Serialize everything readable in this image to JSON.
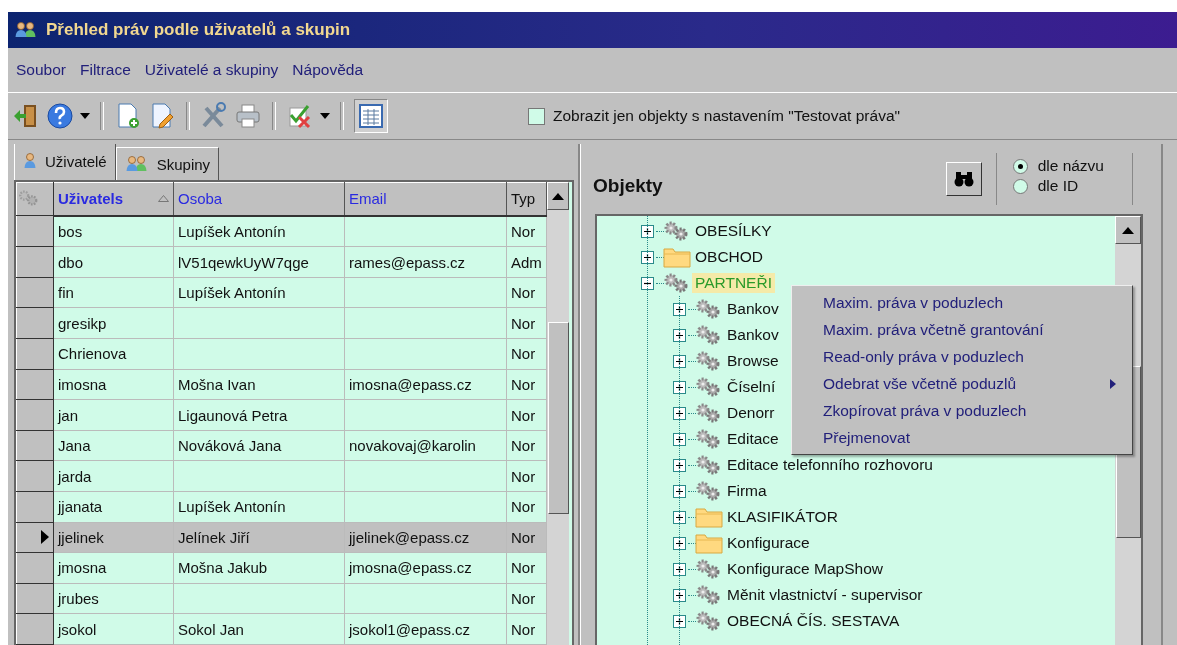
{
  "window": {
    "title": "Přehled práv podle uživatelů a skupin"
  },
  "menu": [
    "Soubor",
    "Filtrace",
    "Uživatelé a skupiny",
    "Nápověda"
  ],
  "toolbar": [
    {
      "kind": "exit"
    },
    {
      "kind": "help"
    },
    {
      "kind": "caret"
    },
    {
      "kind": "sep"
    },
    {
      "kind": "new"
    },
    {
      "kind": "edit"
    },
    {
      "kind": "sep"
    },
    {
      "kind": "tools"
    },
    {
      "kind": "print"
    },
    {
      "kind": "sep"
    },
    {
      "kind": "checkx"
    },
    {
      "kind": "caret"
    },
    {
      "kind": "sep"
    },
    {
      "kind": "grid",
      "pressed": true
    }
  ],
  "filter_checkbox": {
    "label": "Zobrazit jen objekty s nastavením \"Testovat práva\"",
    "checked": false
  },
  "tabs": [
    {
      "label": "Uživatelé",
      "selected": true
    },
    {
      "label": "Skupiny",
      "selected": false
    }
  ],
  "table": {
    "columns": [
      {
        "label": "Uživatels",
        "sorted": true
      },
      {
        "label": "Osoba",
        "sorted": false
      },
      {
        "label": "Email",
        "sorted": false
      },
      {
        "label": "Typ",
        "sorted": false
      }
    ],
    "rows": [
      {
        "cells": [
          "bos",
          "Lupíšek Antonín",
          "",
          "Nor"
        ],
        "selected": false
      },
      {
        "cells": [
          "dbo",
          "lV51qewkUyW7qge",
          "rames@epass.cz",
          "Adm"
        ],
        "selected": false
      },
      {
        "cells": [
          "fin",
          "Lupíšek Antonín",
          "",
          "Nor"
        ],
        "selected": false
      },
      {
        "cells": [
          "gresikp",
          "",
          "",
          "Nor"
        ],
        "selected": false
      },
      {
        "cells": [
          "Chrienova",
          "",
          "",
          "Nor"
        ],
        "selected": false
      },
      {
        "cells": [
          "imosna",
          "Mošna Ivan",
          "imosna@epass.cz",
          "Nor"
        ],
        "selected": false
      },
      {
        "cells": [
          "jan",
          "Ligaunová Petra",
          "",
          "Nor"
        ],
        "selected": false
      },
      {
        "cells": [
          "Jana",
          "Nováková Jana",
          "novakovaj@karolin",
          "Nor"
        ],
        "selected": false
      },
      {
        "cells": [
          "jarda",
          "",
          "",
          "Nor"
        ],
        "selected": false
      },
      {
        "cells": [
          "jjanata",
          "Lupíšek Antonín",
          "",
          "Nor"
        ],
        "selected": false
      },
      {
        "cells": [
          "jjelinek",
          "Jelínek Jiří",
          "jjelinek@epass.cz",
          "Nor"
        ],
        "selected": true
      },
      {
        "cells": [
          "jmosna",
          "Mošna Jakub",
          "jmosna@epass.cz",
          "Nor"
        ],
        "selected": false
      },
      {
        "cells": [
          "jrubes",
          "",
          "",
          "Nor"
        ],
        "selected": false
      },
      {
        "cells": [
          "jsokol",
          "Sokol Jan",
          "jsokol1@epass.cz",
          "Nor"
        ],
        "selected": false
      }
    ]
  },
  "objects": {
    "title": "Objekty",
    "sort_options": [
      {
        "label": "dle názvu",
        "selected": true
      },
      {
        "label": "dle ID",
        "selected": false
      }
    ],
    "tree": [
      {
        "label": "OBESÍLKY",
        "kind": "gear",
        "expanded": false,
        "selected": false
      },
      {
        "label": "OBCHOD",
        "kind": "folder",
        "expanded": false,
        "selected": false
      },
      {
        "label": "PARTNEŘI",
        "kind": "gear",
        "expanded": true,
        "selected": true,
        "children": [
          {
            "label": "Bankov",
            "kind": "gear",
            "expanded": false,
            "selected": false
          },
          {
            "label": "Bankov",
            "kind": "gear",
            "expanded": false,
            "selected": false
          },
          {
            "label": "Browse",
            "kind": "gear",
            "expanded": false,
            "selected": false
          },
          {
            "label": "Číselní",
            "kind": "gear",
            "expanded": false,
            "selected": false
          },
          {
            "label": "Denorr",
            "kind": "gear",
            "expanded": false,
            "selected": false
          },
          {
            "label": "Editace",
            "kind": "gear",
            "expanded": false,
            "selected": false
          },
          {
            "label": "Editace telefonního rozhovoru",
            "kind": "gear",
            "expanded": false,
            "selected": false
          },
          {
            "label": "Firma",
            "kind": "gear",
            "expanded": false,
            "selected": false
          },
          {
            "label": "KLASIFIKÁTOR",
            "kind": "folder",
            "expanded": false,
            "selected": false
          },
          {
            "label": "Konfigurace",
            "kind": "folder",
            "expanded": false,
            "selected": false
          },
          {
            "label": "Konfigurace MapShow",
            "kind": "gear",
            "expanded": false,
            "selected": false
          },
          {
            "label": "Měnit vlastnictví - supervisor",
            "kind": "gear",
            "expanded": false,
            "selected": false
          },
          {
            "label": "OBECNÁ ČÍS. SESTAVA",
            "kind": "gear",
            "expanded": false,
            "selected": false
          }
        ]
      }
    ]
  },
  "context_menu": [
    {
      "label": "Maxim. práva v poduzlech",
      "submenu": false
    },
    {
      "label": "Maxim. práva včetně grantování",
      "submenu": false
    },
    {
      "label": "Read-only práva v poduzlech",
      "submenu": false
    },
    {
      "label": "Odebrat vše včetně poduzlů",
      "submenu": true
    },
    {
      "label": "Zkopírovat práva v poduzlech",
      "submenu": false
    },
    {
      "label": "Přejmenovat",
      "submenu": false
    }
  ]
}
